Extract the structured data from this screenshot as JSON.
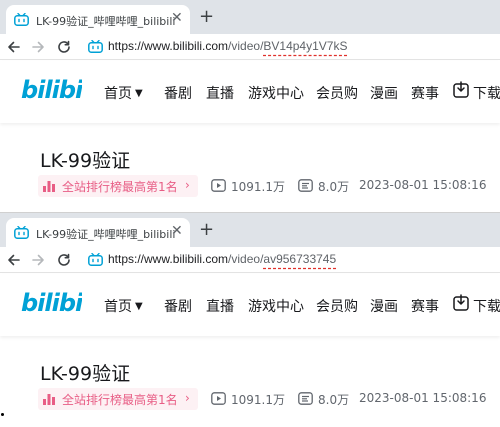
{
  "screens": [
    {
      "tab_title": "LK-99验证_哔哩哔哩_bilibili",
      "url": {
        "domain": "https://www.bilibili.com",
        "path": "/video/",
        "video_id": "BV14p4y1V7kS"
      },
      "nav": {
        "home": "首页",
        "anime": "番剧",
        "live": "直播",
        "game": "游戏中心",
        "vip": "会员购",
        "comic": "漫画",
        "esports": "赛事",
        "download": "下载"
      },
      "video": {
        "title": "LK-99验证",
        "rank_badge": "全站排行榜最高第1名",
        "views": "1091.1万",
        "danmaku": "8.0万",
        "date": "2023-08-01 15:08:16"
      }
    },
    {
      "tab_title": "LK-99验证_哔哩哔哩_bilibili",
      "url": {
        "domain": "https://www.bilibili.com",
        "path": "/video/",
        "video_id": "av956733745"
      },
      "nav": {
        "home": "首页",
        "anime": "番剧",
        "live": "直播",
        "game": "游戏中心",
        "vip": "会员购",
        "comic": "漫画",
        "esports": "赛事",
        "download": "下载"
      },
      "video": {
        "title": "LK-99验证",
        "rank_badge": "全站排行榜最高第1名",
        "views": "1091.1万",
        "danmaku": "8.0万",
        "date": "2023-08-01 15:08:16"
      }
    }
  ],
  "colors": {
    "brand": "#00a1d6",
    "rank_pink": "#e85d85",
    "rank_bg": "#fdf1f4",
    "highlight_red": "#e0302b"
  },
  "icons": {
    "back": "arrow-left-icon",
    "forward": "arrow-right-icon",
    "reload": "reload-icon",
    "site": "bilibili-tv-icon",
    "rank": "bar-chart-icon",
    "views": "play-icon",
    "danmaku": "danmaku-icon",
    "download": "download-icon"
  }
}
